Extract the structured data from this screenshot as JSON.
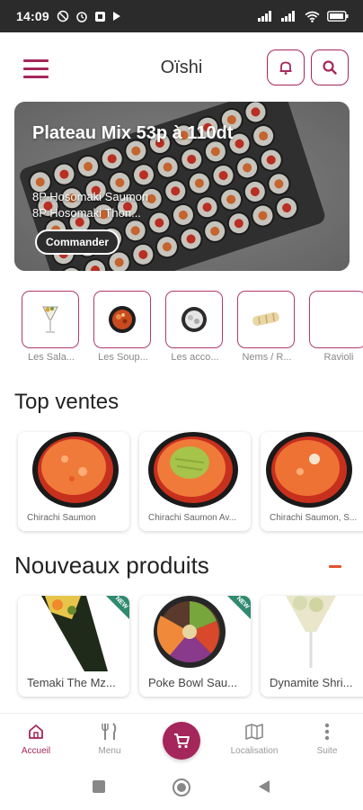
{
  "status_bar": {
    "time": "14:09"
  },
  "app": {
    "title": "Oïshi",
    "accent": "#a5265b"
  },
  "hero": {
    "title": "Plateau Mix 53p à 110dt",
    "line1": "8P Hosomaki Saumon",
    "line2": "8P Hosomaki Thon...",
    "cta": "Commander"
  },
  "categories": [
    {
      "label": "Les Sala..."
    },
    {
      "label": "Les Soup..."
    },
    {
      "label": "Les acco..."
    },
    {
      "label": "Nems / R..."
    },
    {
      "label": "Ravioli"
    }
  ],
  "top_sales": {
    "title": "Top ventes",
    "items": [
      {
        "label": "Chirachi Saumon"
      },
      {
        "label": "Chirachi Saumon Av..."
      },
      {
        "label": "Chirachi Saumon, S..."
      }
    ]
  },
  "new_products": {
    "title": "Nouveaux produits",
    "badge": "NEW",
    "items": [
      {
        "label": "Temaki The Mz..."
      },
      {
        "label": "Poke Bowl Sau..."
      },
      {
        "label": "Dynamite Shri..."
      }
    ]
  },
  "bottom_nav": {
    "home": "Accueil",
    "menu": "Menu",
    "location": "Localisation",
    "more": "Suite"
  }
}
